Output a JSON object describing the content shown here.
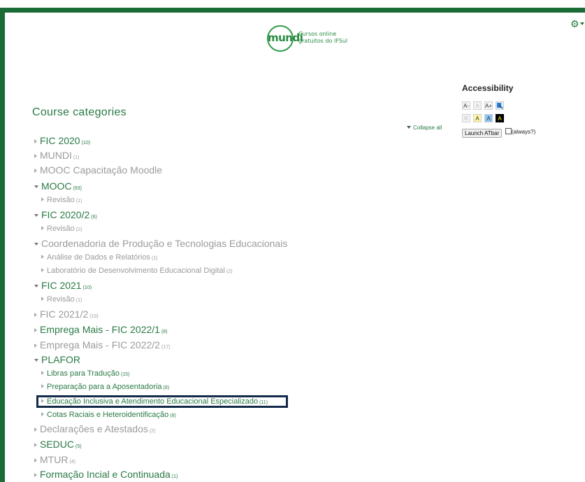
{
  "logo": {
    "word": "mundi",
    "tagline_1": "Cursos online",
    "tagline_2": "gratuitos do IFSul"
  },
  "header": {
    "settings_icon": "gear-icon"
  },
  "accessibility": {
    "title": "Accessibility",
    "buttons_row1": [
      "A-",
      "A",
      "A+",
      ""
    ],
    "buttons_row2": [
      "R",
      "A",
      "A",
      "A"
    ],
    "launch_label": "Launch ATbar",
    "always_label": "(always?)"
  },
  "page": {
    "heading": "Course categories",
    "collapse_all": "Collapse all"
  },
  "categories": [
    {
      "name": "FIC 2020",
      "count": "(10)"
    },
    {
      "name": "MUNDI",
      "count": "(1)"
    },
    {
      "name": "MOOC Capacitação Moodle",
      "count": ""
    },
    {
      "name": "MOOC",
      "count": "(93)"
    },
    {
      "name": "Revisão",
      "count": "(1)"
    },
    {
      "name": "FIC 2020/2",
      "count": "(6)"
    },
    {
      "name": "Revisão",
      "count": "(2)"
    },
    {
      "name": "Coordenadoria de Produção e Tecnologias Educacionais",
      "count": ""
    },
    {
      "name": "Análise de Dados e Relatórios",
      "count": "(1)"
    },
    {
      "name": "Laboratório de Desenvolvimento Educacional Digital",
      "count": "(2)"
    },
    {
      "name": "FIC 2021",
      "count": "(10)"
    },
    {
      "name": "Revisão",
      "count": "(1)"
    },
    {
      "name": "FIC 2021/2",
      "count": "(10)"
    },
    {
      "name": "Emprega Mais - FIC 2022/1",
      "count": "(8)"
    },
    {
      "name": "Emprega Mais - FIC 2022/2",
      "count": "(17)"
    },
    {
      "name": "PLAFOR",
      "count": ""
    },
    {
      "name": "Libras para Tradução",
      "count": "(15)"
    },
    {
      "name": "Preparação para a Aposentadoria",
      "count": "(8)"
    },
    {
      "name": "Educação Inclusiva e Atendimento Educacional Especializado",
      "count": "(11)"
    },
    {
      "name": "Cotas Raciais e Heteroidentificação",
      "count": "(8)"
    },
    {
      "name": "Declarações e Atestados",
      "count": "(2)"
    },
    {
      "name": "SEDUC",
      "count": "(5)"
    },
    {
      "name": "MTUR",
      "count": "(4)"
    },
    {
      "name": "Formação Incial e Continuada",
      "count": "(1)"
    }
  ],
  "colors": {
    "frame": "#1a6b35",
    "link": "#2a7a46",
    "muted": "#9b9b9b",
    "highlight": "#132a4a"
  }
}
